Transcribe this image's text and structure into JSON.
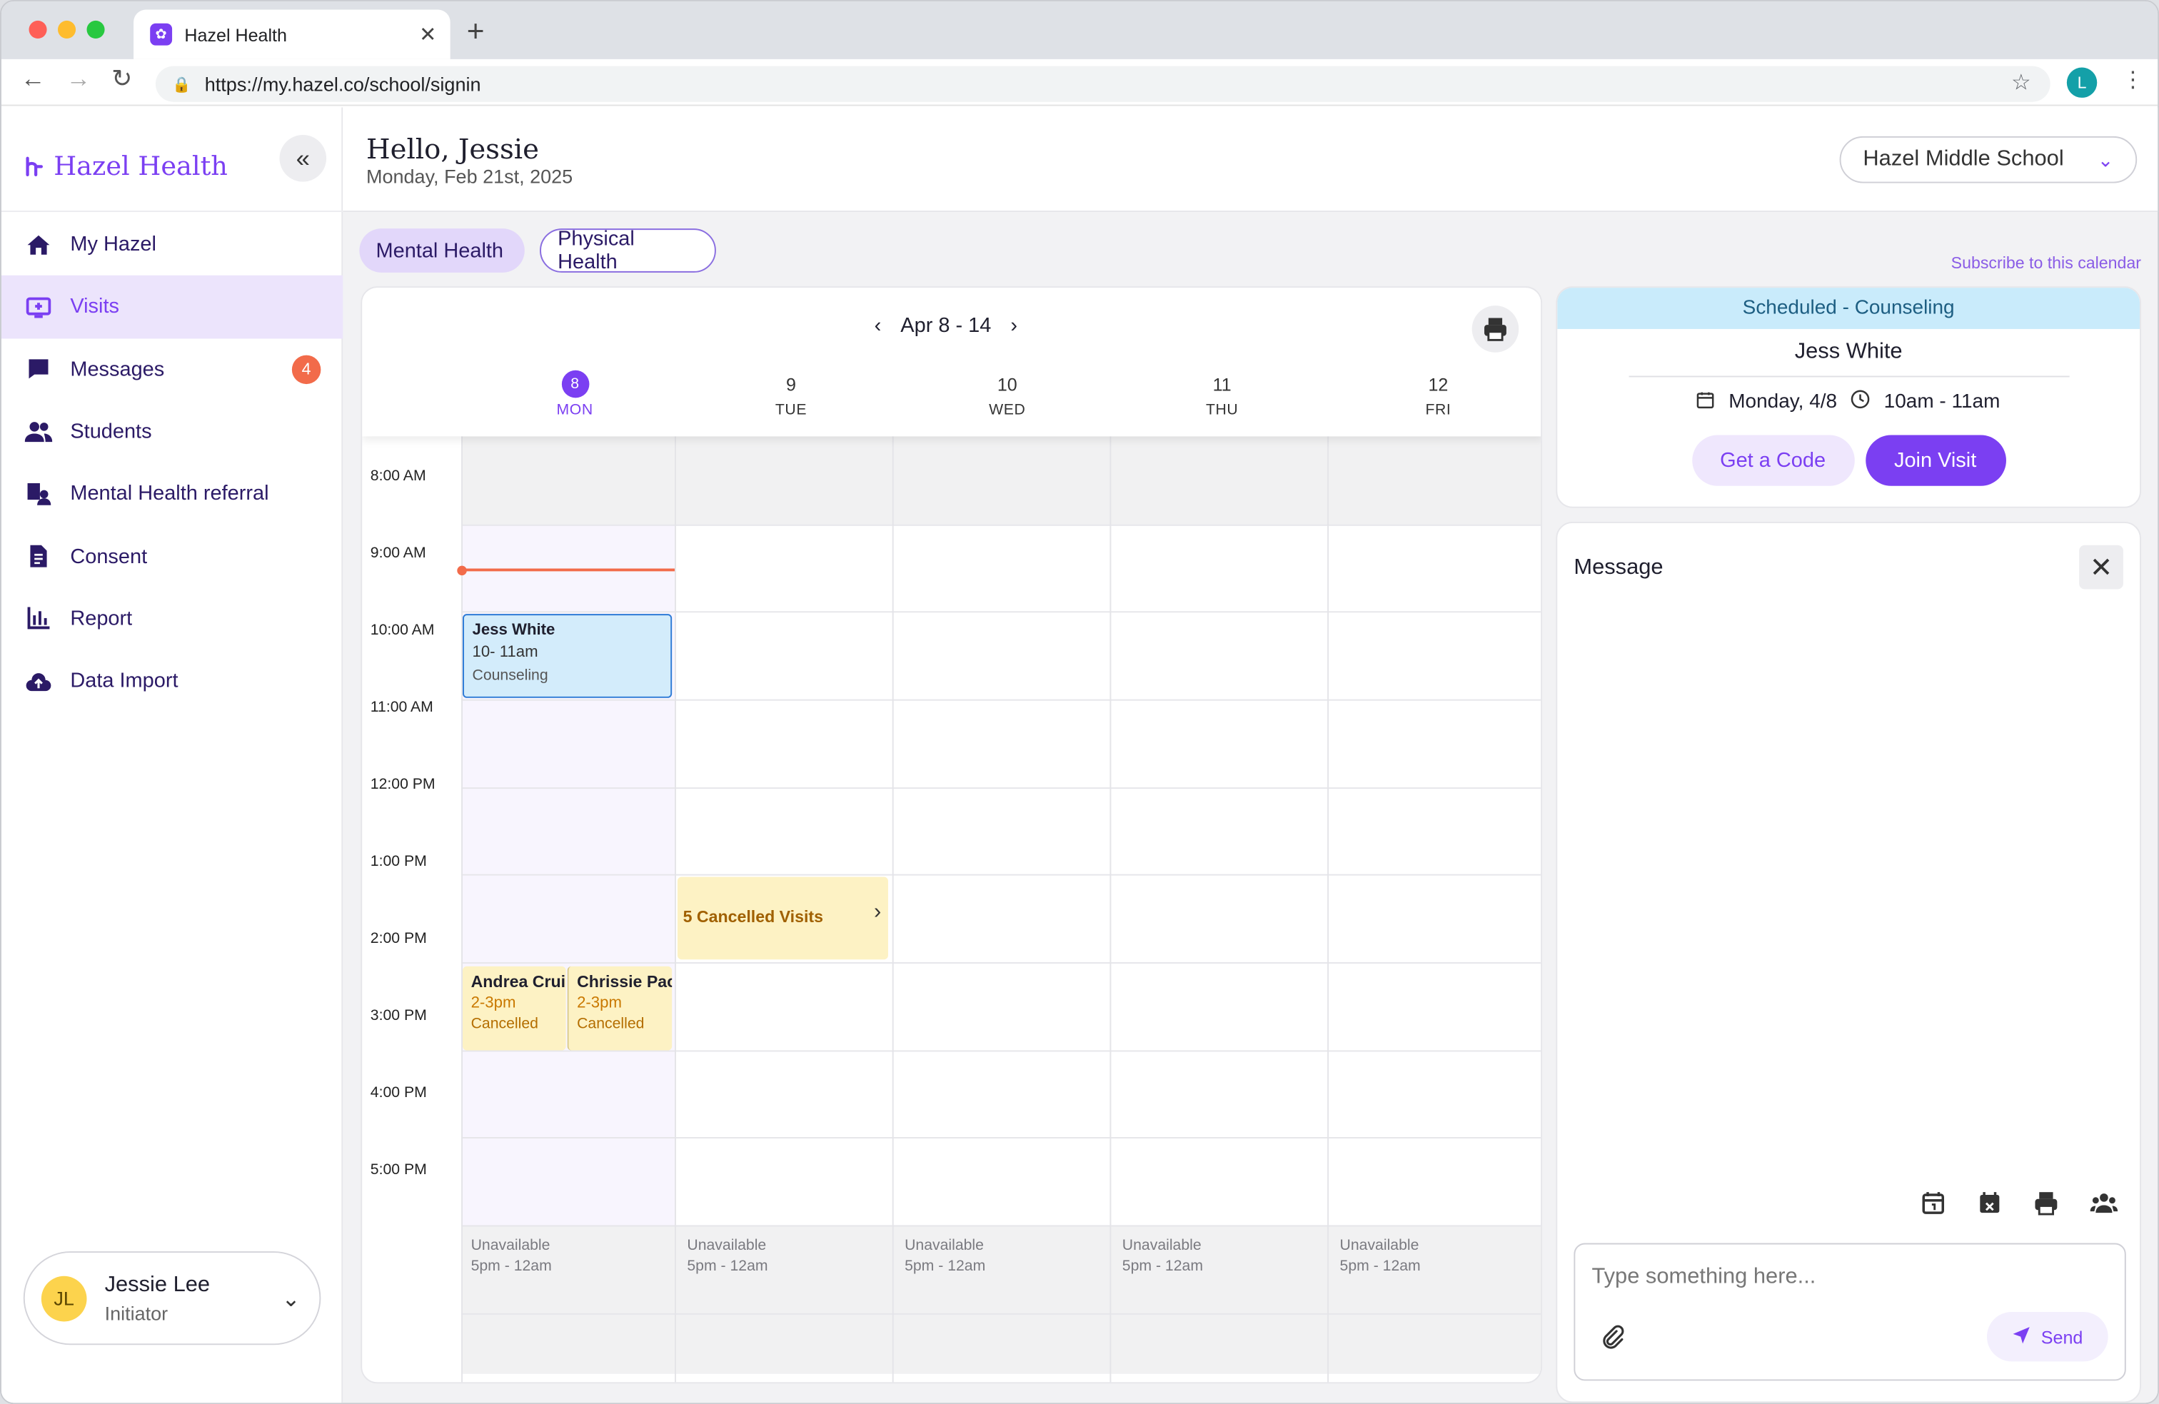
{
  "browser": {
    "tab_title": "Hazel Health",
    "url": "https://my.hazel.co/school/signin",
    "profile_initial": "L"
  },
  "sidebar": {
    "logo": "Hazel Health",
    "items": [
      {
        "label": "My Hazel",
        "icon": "home-icon"
      },
      {
        "label": "Visits",
        "icon": "monitor-plus-icon",
        "active": true
      },
      {
        "label": "Messages",
        "icon": "chat-bubble-icon",
        "badge": "4"
      },
      {
        "label": "Students",
        "icon": "people-icon"
      },
      {
        "label": "Mental Health referral",
        "icon": "referral-icon"
      },
      {
        "label": "Consent",
        "icon": "document-icon"
      },
      {
        "label": "Report",
        "icon": "bar-chart-icon"
      },
      {
        "label": "Data Import",
        "icon": "cloud-upload-icon"
      }
    ],
    "user": {
      "initials": "JL",
      "name": "Jessie Lee",
      "role": "Initiator"
    }
  },
  "header": {
    "greeting": "Hello, Jessie",
    "date": "Monday, Feb 21st, 2025",
    "school": "Hazel Middle School"
  },
  "filters": {
    "mental": "Mental Health",
    "physical": "Physical Health"
  },
  "subscribe_link": "Subscribe to this calendar",
  "calendar": {
    "range": "Apr 8 - 14",
    "days": [
      {
        "num": "8",
        "name": "MON"
      },
      {
        "num": "9",
        "name": "TUE"
      },
      {
        "num": "10",
        "name": "WED"
      },
      {
        "num": "11",
        "name": "THU"
      },
      {
        "num": "12",
        "name": "FRI"
      }
    ],
    "times": [
      "8:00 AM",
      "9:00 AM",
      "10:00 AM",
      "11:00 AM",
      "12:00 PM",
      "1:00 PM",
      "2:00 PM",
      "3:00 PM",
      "4:00 PM",
      "5:00 PM"
    ],
    "unavailable": {
      "line1": "Unavailable",
      "line2": "5pm - 12am"
    },
    "events": {
      "jess": {
        "name": "Jess White",
        "time": "10- 11am",
        "type": "Counseling"
      },
      "cancelled_summary": "5 Cancelled Visits",
      "andrea": {
        "name": "Andrea Cruise",
        "time": "2-3pm",
        "status": "Cancelled"
      },
      "chrissie": {
        "name": "Chrissie Paoli",
        "time": "2-3pm",
        "status": "Cancelled"
      }
    }
  },
  "visit_card": {
    "status": "Scheduled - Counseling",
    "name": "Jess White",
    "date": "Monday, 4/8",
    "time": "10am - 11am",
    "get_code": "Get a Code",
    "join": "Join Visit"
  },
  "message": {
    "title": "Message",
    "placeholder": "Type something here...",
    "send": "Send"
  },
  "colors": {
    "accent": "#7b3ff2",
    "badge": "#f26b4a",
    "scheduled": "#c9ebfb",
    "cancelled": "#fdf2c4"
  }
}
